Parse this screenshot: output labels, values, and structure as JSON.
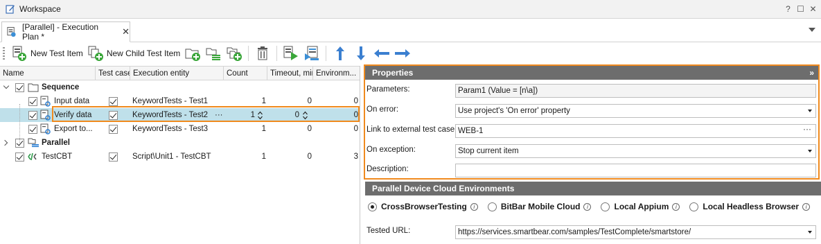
{
  "window": {
    "title": "Workspace",
    "controls": [
      "?",
      "☐",
      "✕"
    ]
  },
  "tab": {
    "label": "[Parallel] - Execution Plan *",
    "close": "✕"
  },
  "toolbar": {
    "new_test_item": "New Test Item",
    "new_child_test_item": "New Child Test Item"
  },
  "grid": {
    "columns": [
      "Name",
      "Test case",
      "Execution entity",
      "Count",
      "Timeout, min",
      "Environm..."
    ],
    "rows": [
      {
        "name": "Sequence",
        "entity": "",
        "count": "",
        "timeout": "",
        "env": ""
      },
      {
        "name": "Input data",
        "entity": "KeywordTests - Test1",
        "count": "1",
        "timeout": "0",
        "env": "0"
      },
      {
        "name": "Verify data",
        "entity": "KeywordTests - Test2",
        "count": "1",
        "timeout": "0",
        "env": "0",
        "ellipsis": "···"
      },
      {
        "name": "Export to...",
        "entity": "KeywordTests - Test3",
        "count": "1",
        "timeout": "0",
        "env": "0"
      },
      {
        "name": "Parallel",
        "entity": "",
        "count": "",
        "timeout": "",
        "env": ""
      },
      {
        "name": "TestCBT",
        "entity": "Script\\Unit1 - TestCBT",
        "count": "1",
        "timeout": "0",
        "env": "3"
      }
    ]
  },
  "properties": {
    "title": "Properties",
    "collapse": "»",
    "parameters_label": "Parameters:",
    "parameters_value": "Param1 (Value = [n\\a])",
    "on_error_label": "On error:",
    "on_error_value": "Use project's 'On error' property",
    "link_label": "Link to external test case:",
    "link_value": "WEB-1",
    "link_ellipsis": "···",
    "on_exception_label": "On exception:",
    "on_exception_value": "Stop current item",
    "description_label": "Description:",
    "description_value": ""
  },
  "parallel": {
    "title": "Parallel Device Cloud Environments",
    "options": [
      "CrossBrowserTesting",
      "BitBar Mobile Cloud",
      "Local Appium",
      "Local Headless Browser"
    ],
    "selected": "CrossBrowserTesting",
    "info_glyph": "i",
    "url_label": "Tested URL:",
    "url_value": "https://services.smartbear.com/samples/TestComplete/smartstore/"
  },
  "colors": {
    "highlight": "#f08a1e",
    "selection": "#bfe0ea",
    "panel_header": "#6d6d6d"
  }
}
